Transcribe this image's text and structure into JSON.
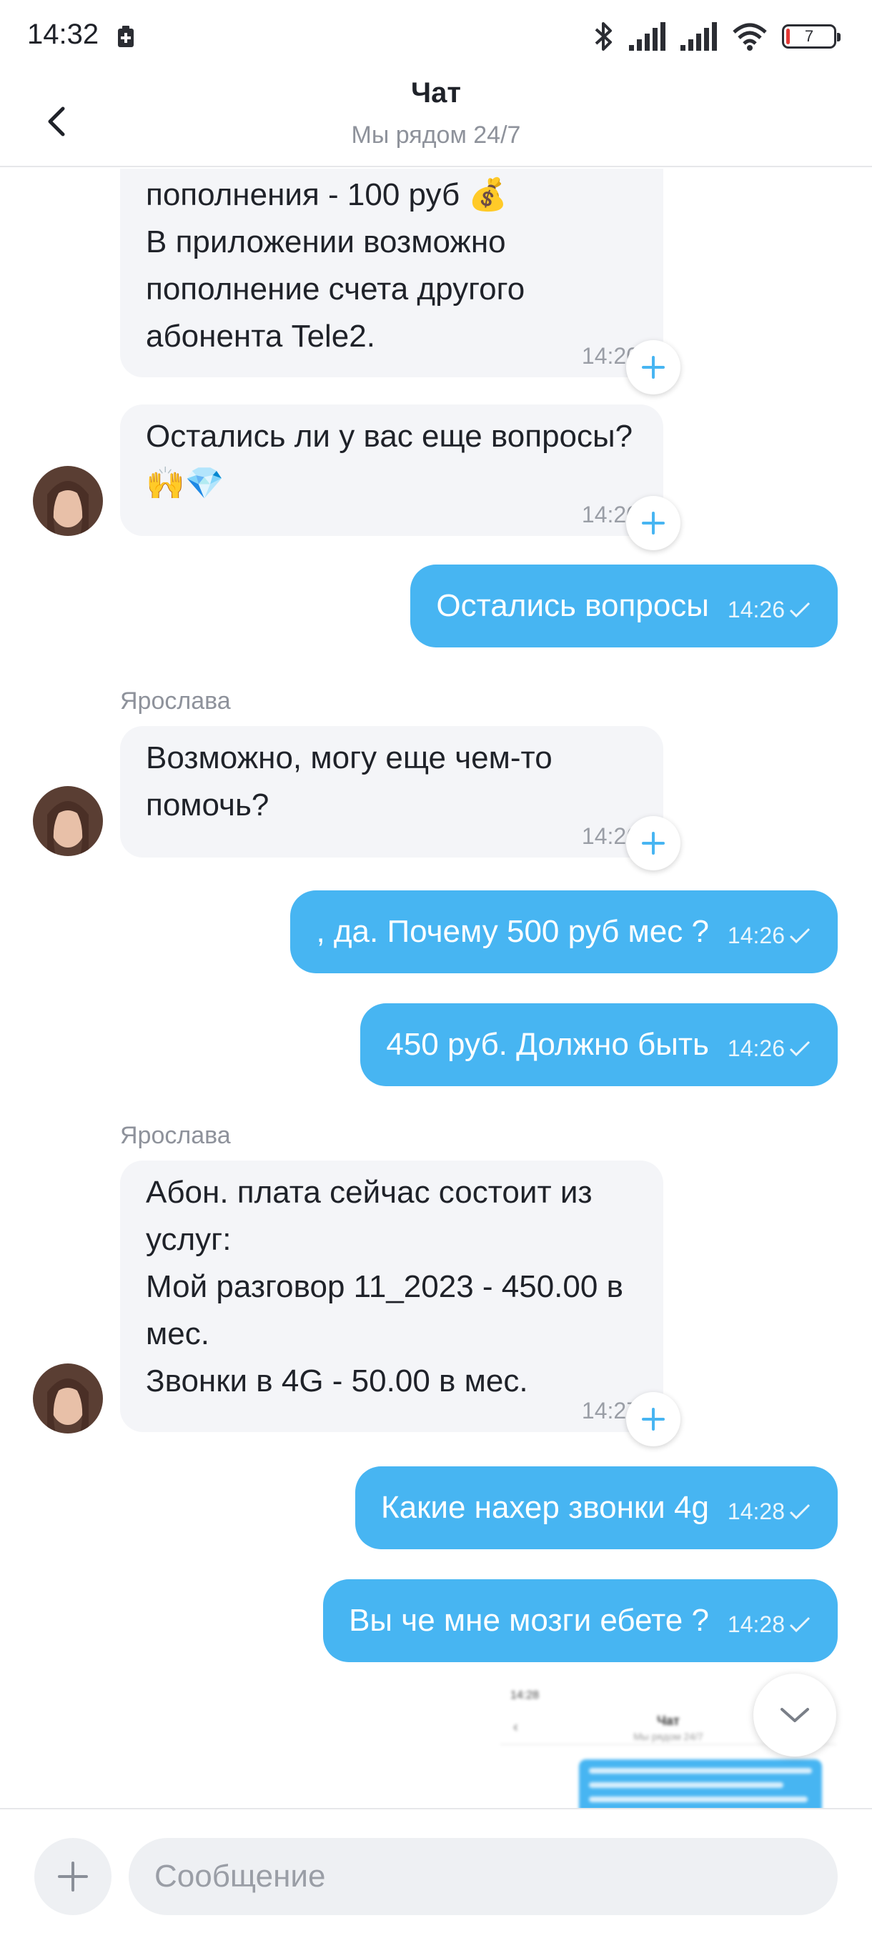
{
  "status_bar": {
    "time": "14:32",
    "battery_level": "7"
  },
  "header": {
    "title": "Чат",
    "subtitle": "Мы рядом 24/7"
  },
  "messages": [
    {
      "direction": "in",
      "text": "пополнения - 100 руб 💰\nВ приложении возможно\nпополнение счета другого\nабонента Tele2.",
      "time": "14:20"
    },
    {
      "direction": "in",
      "text": "Остались ли у вас еще вопросы?\n🙌💎",
      "time": "14:20"
    },
    {
      "direction": "out",
      "text": "Остались вопросы",
      "time": "14:26"
    },
    {
      "direction": "in",
      "sender": "Ярослава",
      "text": "Возможно, могу еще чем-то\nпомочь?",
      "time": "14:26"
    },
    {
      "direction": "out",
      "text": ", да.  Почему 500 руб мес ?",
      "time": "14:26"
    },
    {
      "direction": "out",
      "text": "450 руб. Должно быть",
      "time": "14:26"
    },
    {
      "direction": "in",
      "sender": "Ярослава",
      "text": "Абон. плата сейчас состоит из\nуслуг:\nМой разговор 11_2023 - 450.00 в\nмес.\nЗвонки в 4G - 50.00 в мес.",
      "time": "14:27"
    },
    {
      "direction": "out",
      "text": "Какие нахер звонки 4g",
      "time": "14:28"
    },
    {
      "direction": "out",
      "text": "Вы че мне мозги ебете ?",
      "time": "14:28"
    }
  ],
  "attachment_preview": {
    "time": "14:28",
    "title": "Чат",
    "subtitle": "Мы рядом 24/7"
  },
  "composer": {
    "placeholder": "Сообщение"
  },
  "colors": {
    "outgoing": "#47b5f2",
    "incoming": "#f4f5f8",
    "accent": "#47b5f2"
  }
}
